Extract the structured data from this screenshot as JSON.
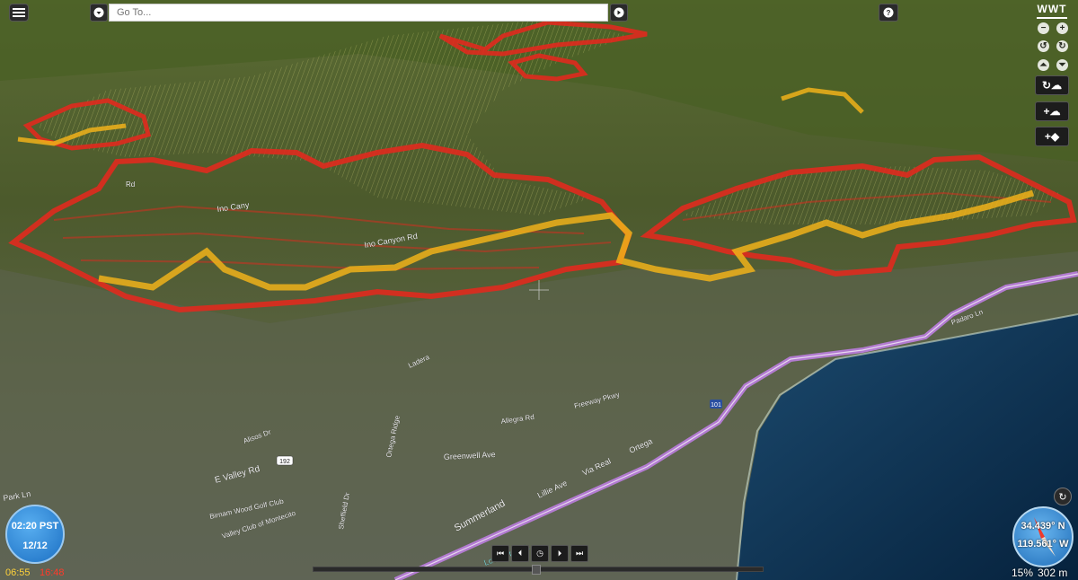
{
  "search": {
    "placeholder": "Go To..."
  },
  "logo_text": "WWT",
  "clock": {
    "time": "02:20 PST",
    "date": "12/12"
  },
  "sun": {
    "sunrise": "06:55",
    "sunset": "16:48"
  },
  "compass": {
    "lat": "34.439° N",
    "lon": "119.561° W"
  },
  "status": {
    "zoom_pct": "15%",
    "altitude": "302 m"
  },
  "map_labels": [
    "Ino Cany",
    "Ino Canyon Rd",
    "Summerland",
    "Greenwell Ave",
    "E Valley Rd",
    "Birnam Wood Golf Club",
    "Valley Club of Montecito",
    "Lillie Ave",
    "Via Real",
    "Ortega",
    "Lookout Park",
    "Sheffield Dr",
    "Ortega Ridge",
    "Padaro Ln",
    "Alisos Dr",
    "Park Ln",
    "Ladera",
    "Allegra Rd",
    "Freeway Pkwy",
    "Rd"
  ],
  "highways": [
    "101",
    "192"
  ],
  "colors": {
    "perimeter_red": "#e02a1e",
    "perimeter_yellow": "#f0b21a",
    "ocean": "#0a2a48",
    "highway": "#b27bd0"
  }
}
